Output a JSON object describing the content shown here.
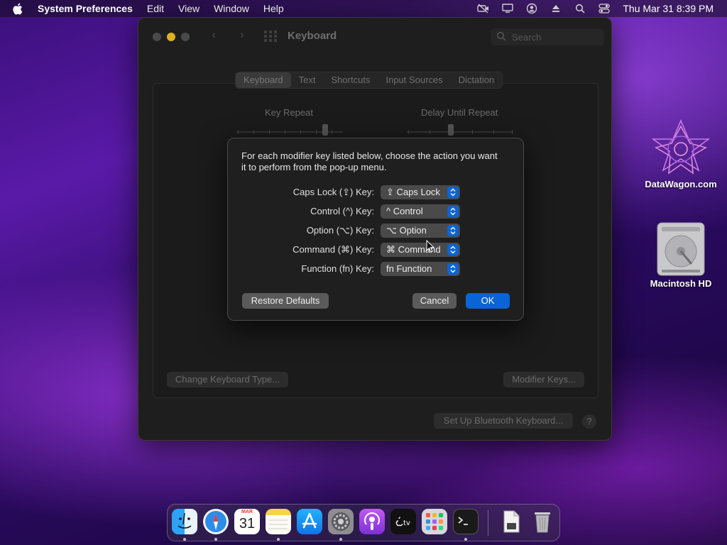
{
  "menubar": {
    "app_name": "System Preferences",
    "items": [
      "Edit",
      "View",
      "Window",
      "Help"
    ],
    "clock": "Thu Mar 31  8:39 PM",
    "status_icons": [
      "camera-off-icon",
      "display-icon",
      "user-icon",
      "eject-icon",
      "search-icon",
      "control-center-icon"
    ]
  },
  "window": {
    "title": "Keyboard",
    "search_placeholder": "Search",
    "tabs": [
      "Keyboard",
      "Text",
      "Shortcuts",
      "Input Sources",
      "Dictation"
    ],
    "active_tab": "Keyboard",
    "key_repeat_label": "Key Repeat",
    "delay_label": "Delay Until Repeat",
    "change_keyboard_type": "Change Keyboard Type...",
    "modifier_keys": "Modifier Keys...",
    "bluetooth_keyboard": "Set Up Bluetooth Keyboard...",
    "help": "?"
  },
  "sheet": {
    "description": "For each modifier key listed below, choose the action you want it to perform from the pop-up menu.",
    "rows": [
      {
        "label": "Caps Lock (⇪) Key:",
        "value": "⇪ Caps Lock"
      },
      {
        "label": "Control (^) Key:",
        "value": "^ Control"
      },
      {
        "label": "Option (⌥) Key:",
        "value": "⌥ Option"
      },
      {
        "label": "Command (⌘) Key:",
        "value": "⌘ Command"
      },
      {
        "label": "Function (fn) Key:",
        "value": "fn Function"
      }
    ],
    "restore_defaults": "Restore Defaults",
    "cancel": "Cancel",
    "ok": "OK"
  },
  "desktop": {
    "icons": [
      {
        "label": "DataWagon.com"
      },
      {
        "label": "Macintosh HD"
      }
    ]
  },
  "dock": {
    "calendar_month": "MAR",
    "calendar_day": "31",
    "apps": [
      "finder",
      "safari",
      "calendar",
      "notes",
      "app-store",
      "system-preferences",
      "podcasts",
      "apple-tv",
      "launchpad",
      "terminal",
      "preview-file",
      "trash"
    ],
    "colors": {
      "finder": "#1e8cf0",
      "safari": "#2b8de8",
      "app_store": "#1f8af5",
      "podcasts": "#9b3fe0",
      "accent": "#0a64d6"
    }
  }
}
